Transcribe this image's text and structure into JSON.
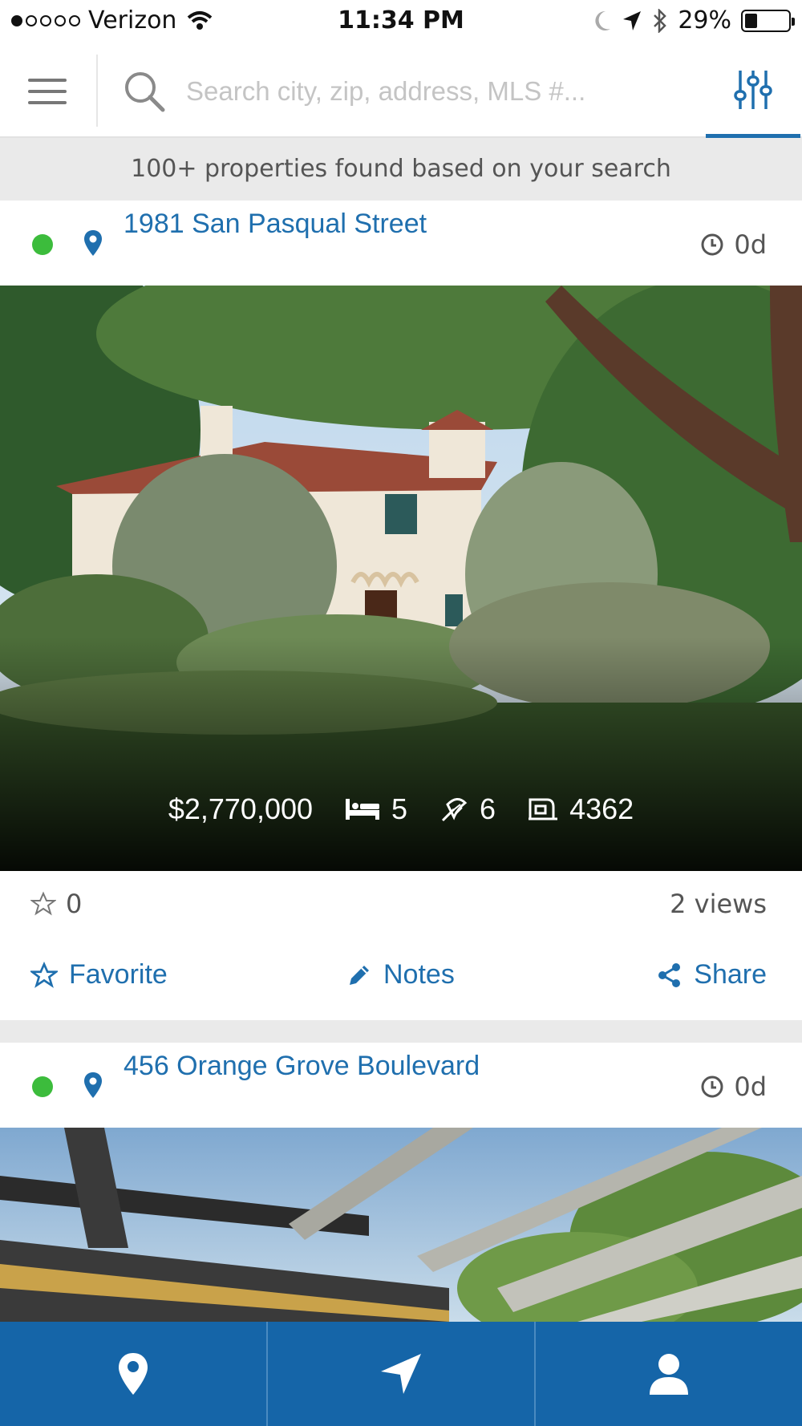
{
  "status_bar": {
    "carrier": "Verizon",
    "time": "11:34 PM",
    "battery": "29%",
    "battery_level": 0.29,
    "signal_bars_filled": 1,
    "signal_bars_total": 5
  },
  "search": {
    "placeholder": "Search city, zip, address, MLS #...",
    "value": ""
  },
  "results_banner": "100+ properties found based on your search",
  "colors": {
    "accent": "#1f6fae",
    "nav_bar": "#1565a8",
    "active_dot": "#3cbc3c"
  },
  "listings": [
    {
      "address": "1981 San Pasqual Street",
      "age": "0d",
      "price": "$2,770,000",
      "beds": "5",
      "baths": "6",
      "sqft": "4362",
      "favorites": "0",
      "views": "2 views",
      "actions": {
        "favorite": "Favorite",
        "notes": "Notes",
        "share": "Share"
      }
    },
    {
      "address": "456 Orange Grove Boulevard",
      "age": "0d"
    }
  ],
  "bottom_nav": [
    {
      "icon": "map-pin-icon"
    },
    {
      "icon": "navigation-arrow-icon"
    },
    {
      "icon": "user-icon"
    }
  ]
}
